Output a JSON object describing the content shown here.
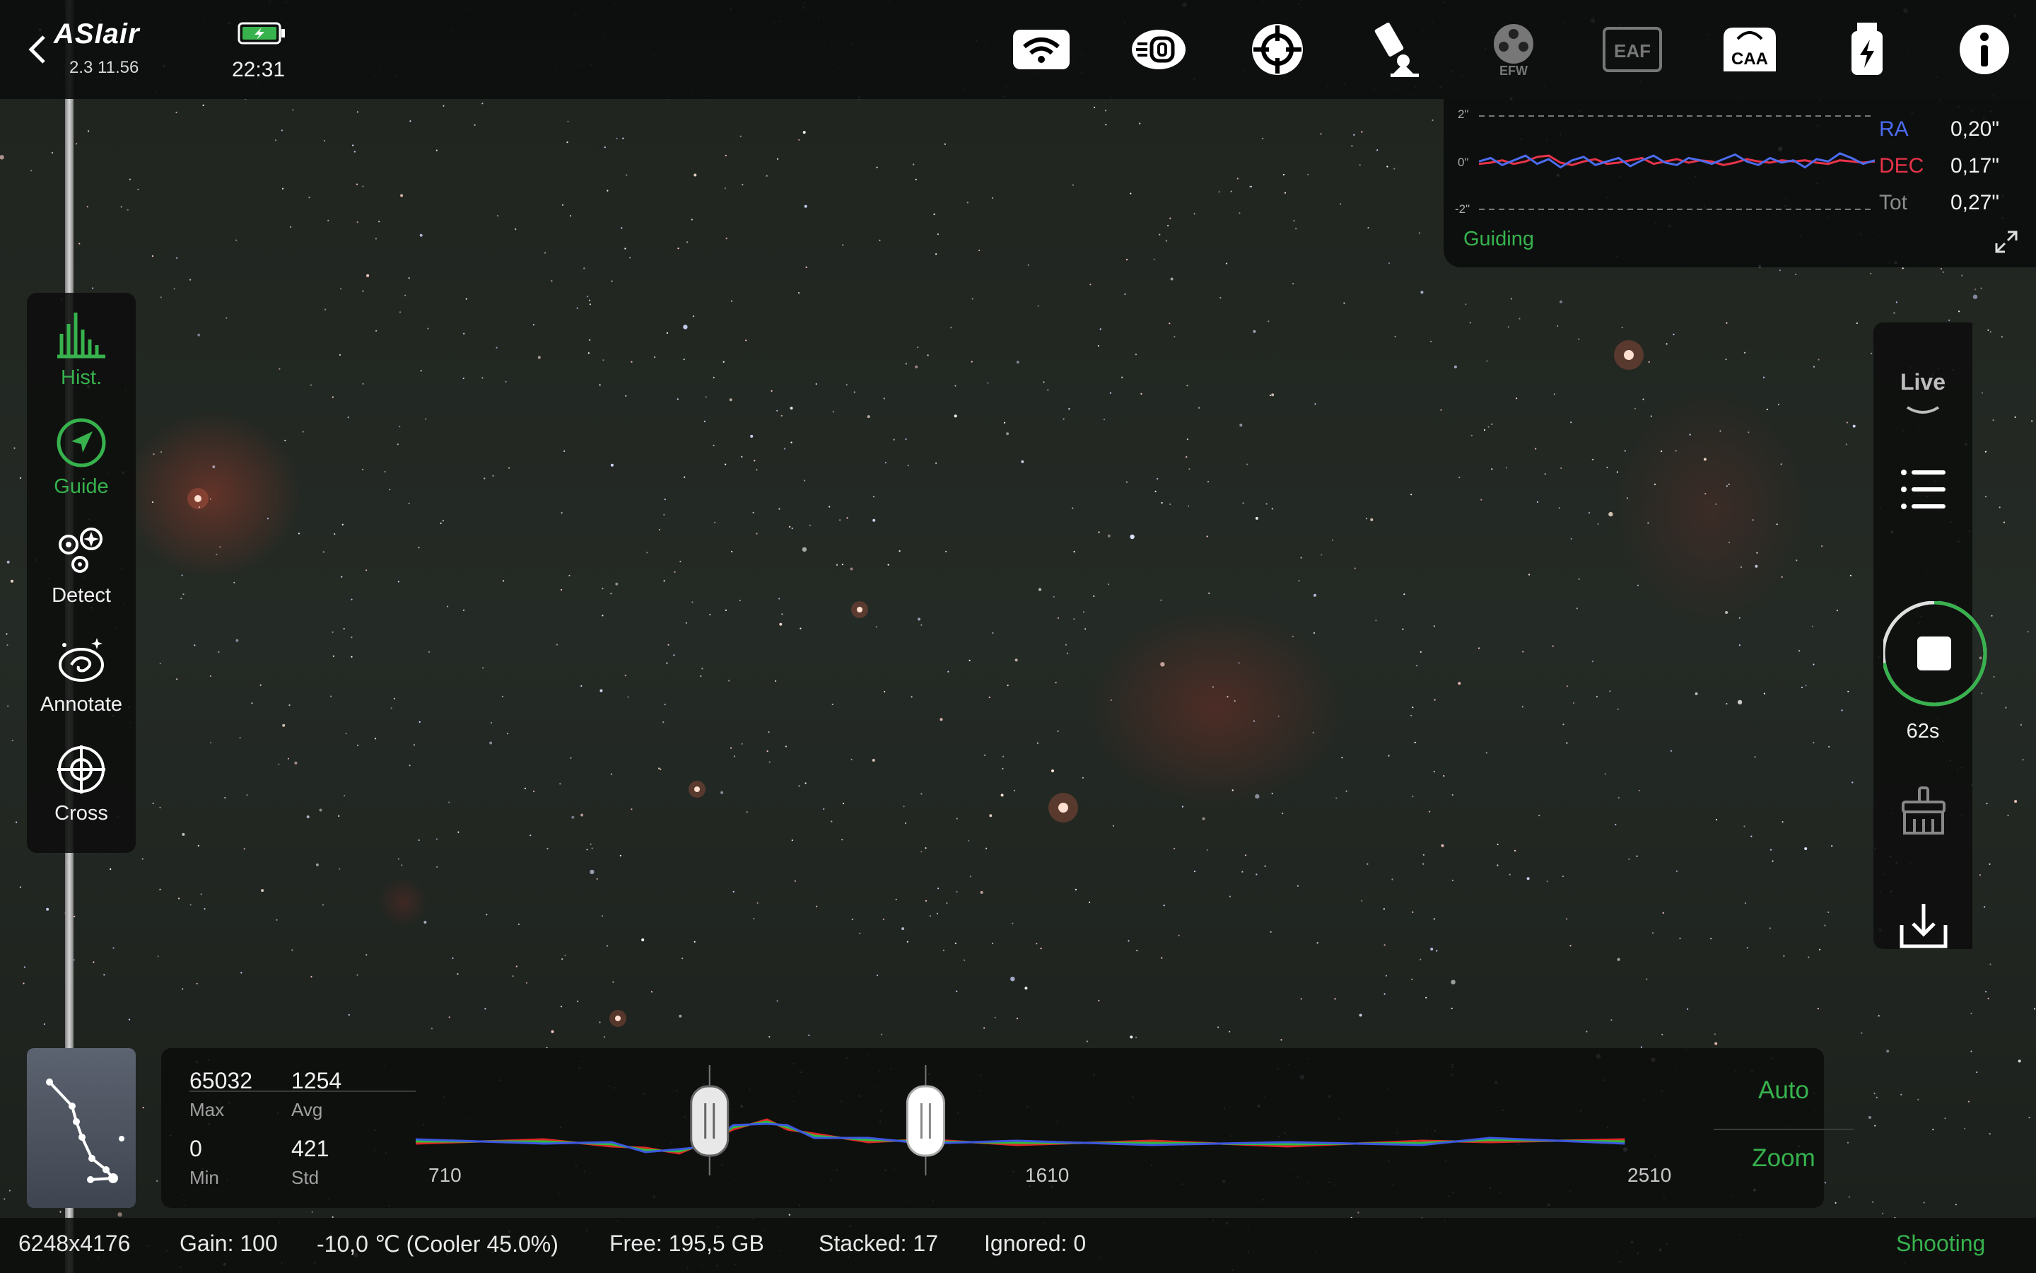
{
  "app": {
    "name": "ASIair",
    "version": "2.3 11.56",
    "time": "22:31"
  },
  "topbar": {
    "icons": [
      {
        "name": "wifi-icon",
        "label": ""
      },
      {
        "name": "camera-icon",
        "label": ""
      },
      {
        "name": "guide-scope-icon",
        "label": ""
      },
      {
        "name": "mount-icon",
        "label": ""
      },
      {
        "name": "filter-wheel-icon",
        "label": "EFW"
      },
      {
        "name": "focuser-icon",
        "label": "EAF"
      },
      {
        "name": "rotator-icon",
        "label": "CAA"
      },
      {
        "name": "storage-icon",
        "label": ""
      },
      {
        "name": "info-icon",
        "label": ""
      }
    ]
  },
  "guiding": {
    "scale_top": "2\"",
    "scale_mid": "0\"",
    "scale_bottom": "-2\"",
    "ra_label": "RA",
    "ra_value": "0,20\"",
    "dec_label": "DEC",
    "dec_value": "0,17\"",
    "tot_label": "Tot",
    "tot_value": "0,27\"",
    "status": "Guiding",
    "colors": {
      "ra": "#4c6cf0",
      "dec": "#e8334a"
    },
    "ra_series": [
      0.05,
      0.2,
      -0.1,
      0.1,
      0.3,
      -0.05,
      0.15,
      -0.2,
      0.1,
      0.25,
      -0.1,
      0.05,
      0.2,
      -0.15,
      0.1,
      0.3,
      0.0,
      -0.1,
      0.2,
      0.1,
      -0.05,
      0.15,
      0.35,
      0.05,
      -0.1,
      0.2,
      0.0,
      0.1,
      -0.2,
      0.15,
      0.05,
      0.4,
      0.2,
      -0.05,
      0.1
    ],
    "dec_series": [
      -0.05,
      0.0,
      0.1,
      -0.05,
      0.05,
      0.25,
      0.3,
      0.0,
      -0.1,
      0.05,
      0.15,
      -0.05,
      0.0,
      0.1,
      0.2,
      -0.05,
      0.05,
      0.15,
      0.0,
      0.1,
      0.05,
      -0.1,
      0.0,
      0.15,
      0.05,
      0.0,
      0.1,
      0.05,
      0.1,
      0.0,
      -0.05,
      0.1,
      0.05,
      0.0,
      0.05
    ]
  },
  "left_tools": [
    {
      "label": "Hist.",
      "active": true,
      "icon": "histogram-icon"
    },
    {
      "label": "Guide",
      "active": true,
      "icon": "guide-icon"
    },
    {
      "label": "Detect",
      "active": false,
      "icon": "detect-stars-icon"
    },
    {
      "label": "Annotate",
      "active": false,
      "icon": "annotate-galaxy-icon"
    },
    {
      "label": "Cross",
      "active": false,
      "icon": "crosshair-icon"
    }
  ],
  "right_tools": {
    "mode": "Live",
    "exposure_remaining": "62s",
    "progress": 0.72
  },
  "histogram": {
    "max_value": "65032",
    "max_label": "Max",
    "avg_value": "1254",
    "avg_label": "Avg",
    "min_value": "0",
    "min_label": "Min",
    "std_value": "421",
    "std_label": "Std",
    "axis_left": "710",
    "axis_mid": "1610",
    "axis_right": "2510",
    "auto_label": "Auto",
    "zoom_label": "Zoom",
    "black_point": 1145,
    "white_point": 1465,
    "colors": {
      "red": "#e02828",
      "green": "#2fbf3a",
      "blue": "#3d57e0"
    }
  },
  "status": {
    "resolution": "6248x4176",
    "gain": "Gain: 100",
    "temperature": "-10,0 ℃ (Cooler 45.0%)",
    "free": "Free: 195,5 GB",
    "stacked": "Stacked: 17",
    "ignored": "Ignored: 0",
    "state": "Shooting"
  }
}
